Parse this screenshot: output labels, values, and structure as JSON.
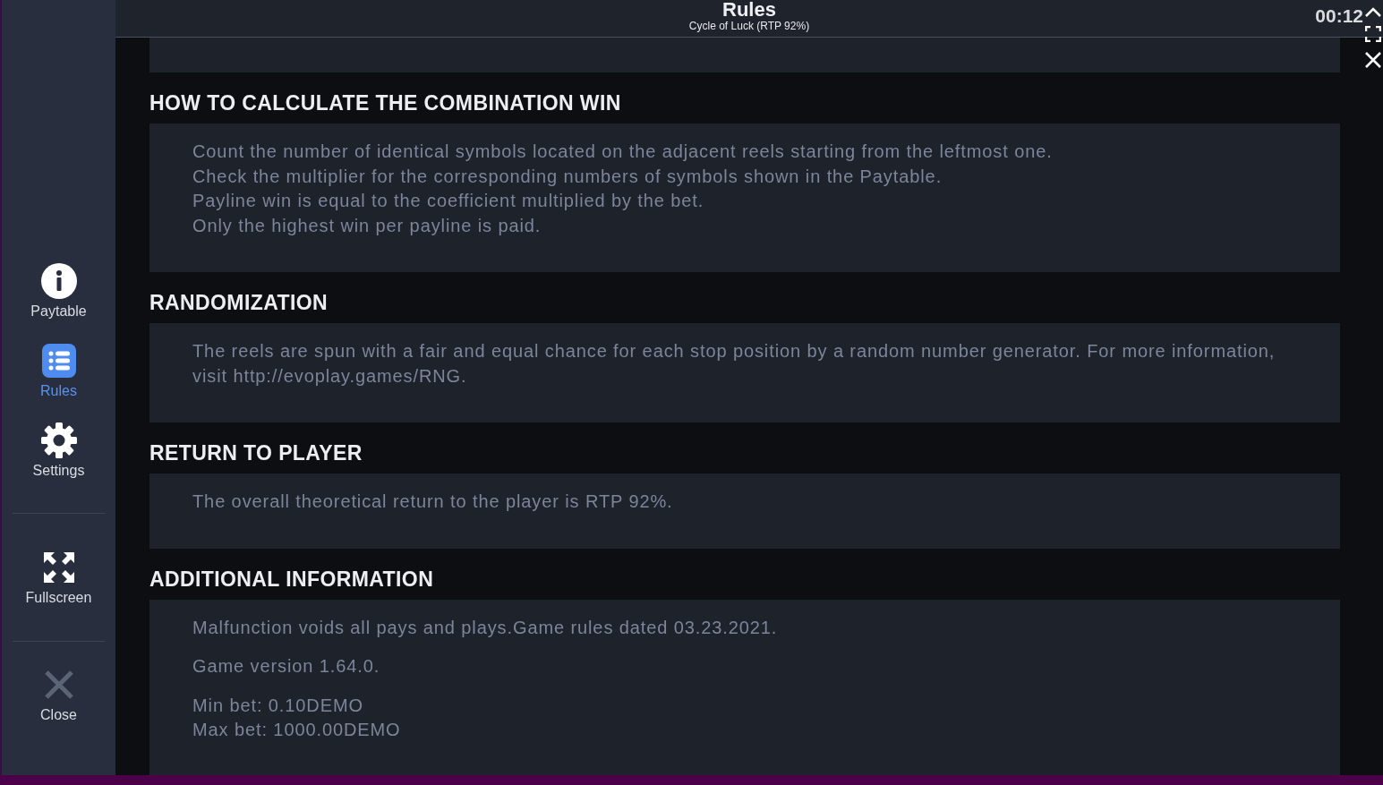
{
  "header": {
    "title": "Rules",
    "subtitle": "Cycle of Luck (RTP 92%)",
    "timer": "00:12"
  },
  "sidebar": {
    "groups": [
      {
        "items": [
          {
            "label": "Paytable",
            "kind": "info",
            "selected": false
          },
          {
            "label": "Rules",
            "kind": "list",
            "selected": true
          },
          {
            "label": "Settings",
            "kind": "gear",
            "selected": false
          }
        ]
      },
      {
        "items": [
          {
            "label": "Fullscreen",
            "kind": "fullscreen",
            "selected": false
          }
        ]
      },
      {
        "items": [
          {
            "label": "Close",
            "kind": "close",
            "selected": false
          }
        ]
      }
    ]
  },
  "sections": [
    {
      "heading": "HOW TO CALCULATE THE COMBINATION WIN",
      "blocks": [
        {
          "lines": [
            "Count the number of identical symbols located on the adjacent reels starting from the leftmost one.",
            "Check the multiplier for the corresponding numbers of symbols shown in the Paytable.",
            "Payline win is equal to the coefficient multiplied by the bet.",
            "Only the highest win per payline is paid."
          ]
        }
      ]
    },
    {
      "heading": "RANDOMIZATION",
      "blocks": [
        {
          "lines": [
            "The reels are spun with a fair and equal chance for each stop position by a random number generator. For more information, visit http://evoplay.games/RNG."
          ]
        }
      ]
    },
    {
      "heading": "RETURN TO PLAYER",
      "blocks": [
        {
          "lines": [
            "The overall theoretical return to the player is RTP 92%."
          ]
        }
      ]
    },
    {
      "heading": "ADDITIONAL INFORMATION",
      "blocks": [
        {
          "lines": [
            "Malfunction voids all pays and plays.Game rules dated 03.23.2021."
          ]
        },
        {
          "lines": [
            "Game version 1.64.0."
          ]
        },
        {
          "lines": [
            "Min bet: 0.10DEMO",
            "Max bet: 1000.00DEMO"
          ]
        }
      ]
    }
  ]
}
